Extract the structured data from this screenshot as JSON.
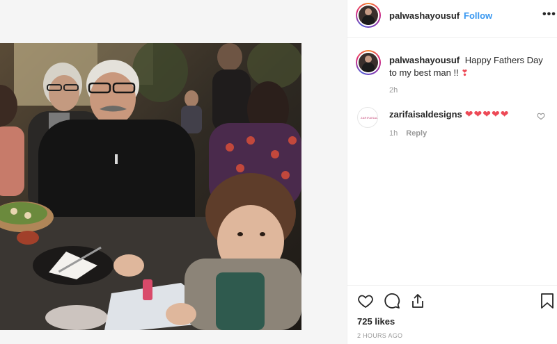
{
  "post": {
    "author": "palwashayousuf",
    "follow_label": "Follow",
    "dot": "•",
    "more_label": "•••"
  },
  "caption": {
    "username": "palwashayousuf",
    "text": "Happy Fathers Day to my best man !!",
    "emoji": "❣",
    "time": "2h"
  },
  "comments": [
    {
      "username": "zarifaisaldesigns",
      "avatar_text": "ZARIFAISAL",
      "hearts": "❤❤❤❤❤",
      "time": "1h",
      "reply_label": "Reply"
    }
  ],
  "footer": {
    "likes": "725 likes",
    "timestamp": "2 HOURS AGO"
  },
  "icons": {
    "like": "heart-icon",
    "comment": "comment-icon",
    "share": "share-icon",
    "save": "bookmark-icon",
    "more": "more-icon"
  },
  "colors": {
    "link": "#3897f0",
    "heart": "#ed4956",
    "muted": "#999999"
  }
}
